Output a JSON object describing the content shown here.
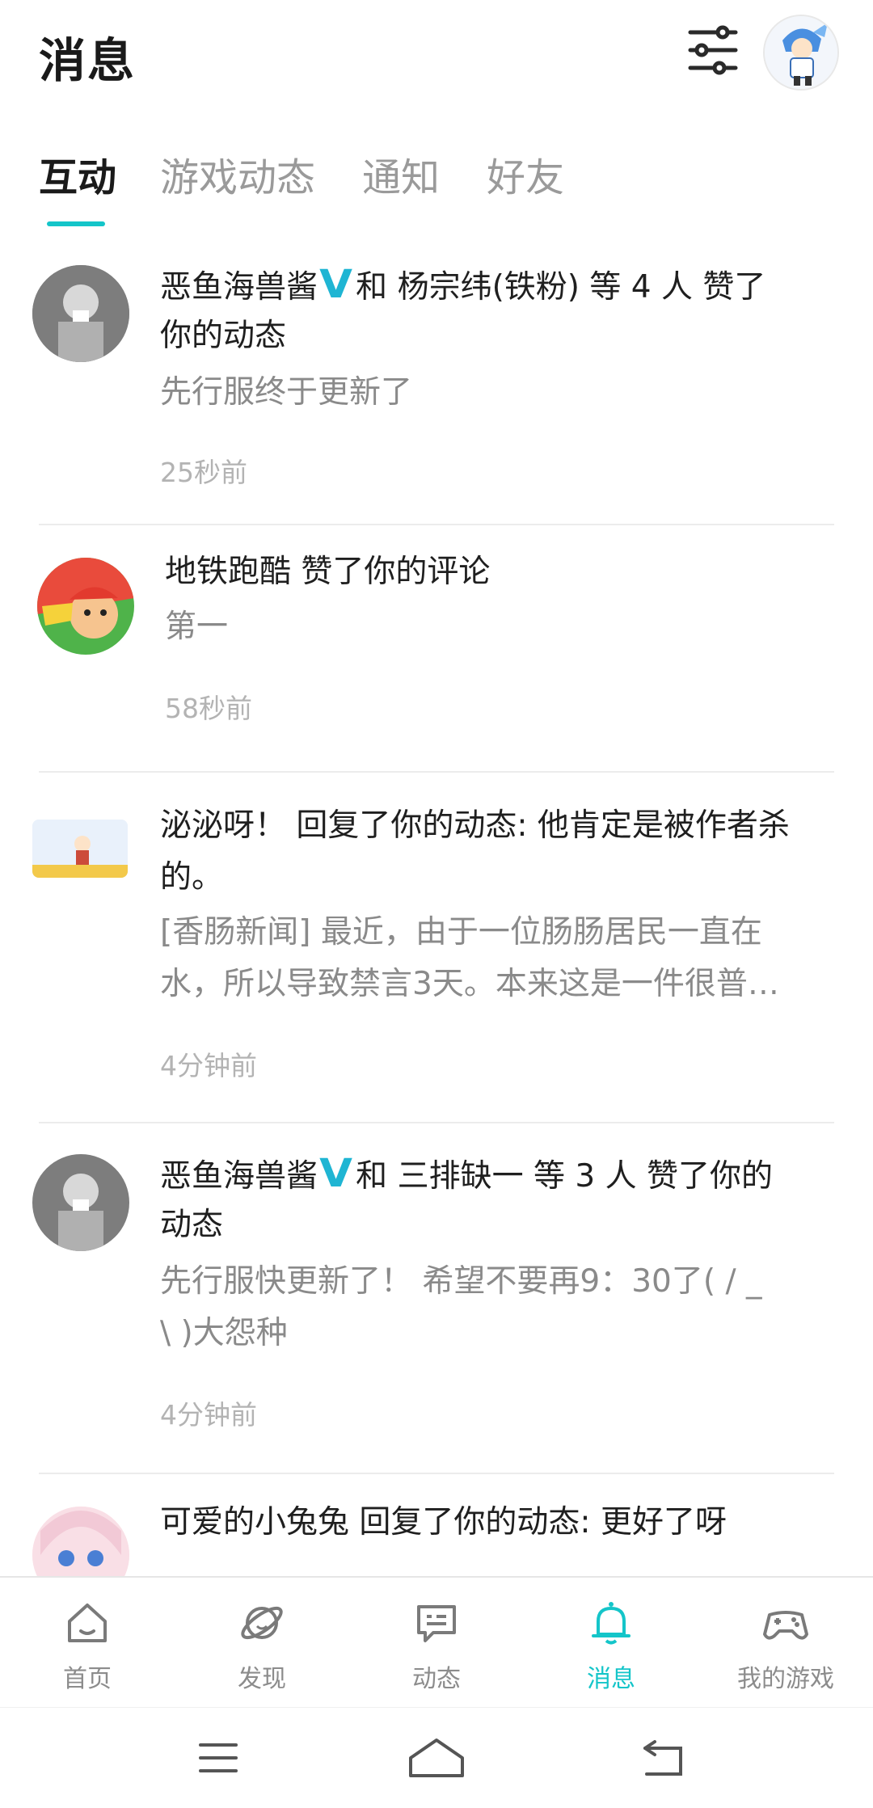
{
  "header": {
    "title": "消息"
  },
  "tabs": [
    {
      "label": "互动"
    },
    {
      "label": "游戏动态"
    },
    {
      "label": "通知"
    },
    {
      "label": "好友"
    }
  ],
  "messages": [
    {
      "name": "恶鱼海兽酱",
      "verified": true,
      "action": "和 杨宗纬(铁粉) 等 4 人 赞了你的动态",
      "action_line1": "和 杨宗纬(铁粉) 等 4 人 赞了",
      "action_line2": "你的动态",
      "sub": "先行服终于更新了",
      "time": "25秒前"
    },
    {
      "name": "地铁跑酷",
      "verified": false,
      "action": "赞了你的评论",
      "sub": "第一",
      "time": "58秒前"
    },
    {
      "name": "泌泌呀！",
      "verified": false,
      "action_line1": "泌泌呀！ 回复了你的动态: 他肯定是被作者杀",
      "action_line2": "的。",
      "sub_line1": "[香肠新闻] 最近，由于一位肠肠居民一直在",
      "sub_line2": "水，所以导致禁言3天。本来这是一件很普…",
      "time": "4分钟前"
    },
    {
      "name": "恶鱼海兽酱",
      "verified": true,
      "action_line1": "和 三排缺一 等 3 人 赞了你的",
      "action_line2": "动态",
      "sub_line1": "先行服快更新了！ 希望不要再9：30了( / _",
      "sub_line2": "\\ )大怨种",
      "time": "4分钟前"
    },
    {
      "name": "可爱的小兔兔",
      "verified": false,
      "action": "回复了你的动态: 更好了呀"
    }
  ],
  "bottom_nav": [
    {
      "label": "首页",
      "icon": "home-icon"
    },
    {
      "label": "发现",
      "icon": "planet-icon"
    },
    {
      "label": "动态",
      "icon": "chat-icon"
    },
    {
      "label": "消息",
      "icon": "bell-icon"
    },
    {
      "label": "我的游戏",
      "icon": "gamepad-icon"
    }
  ],
  "colors": {
    "accent": "#14c5c9",
    "verified": "#1fb5d3"
  }
}
